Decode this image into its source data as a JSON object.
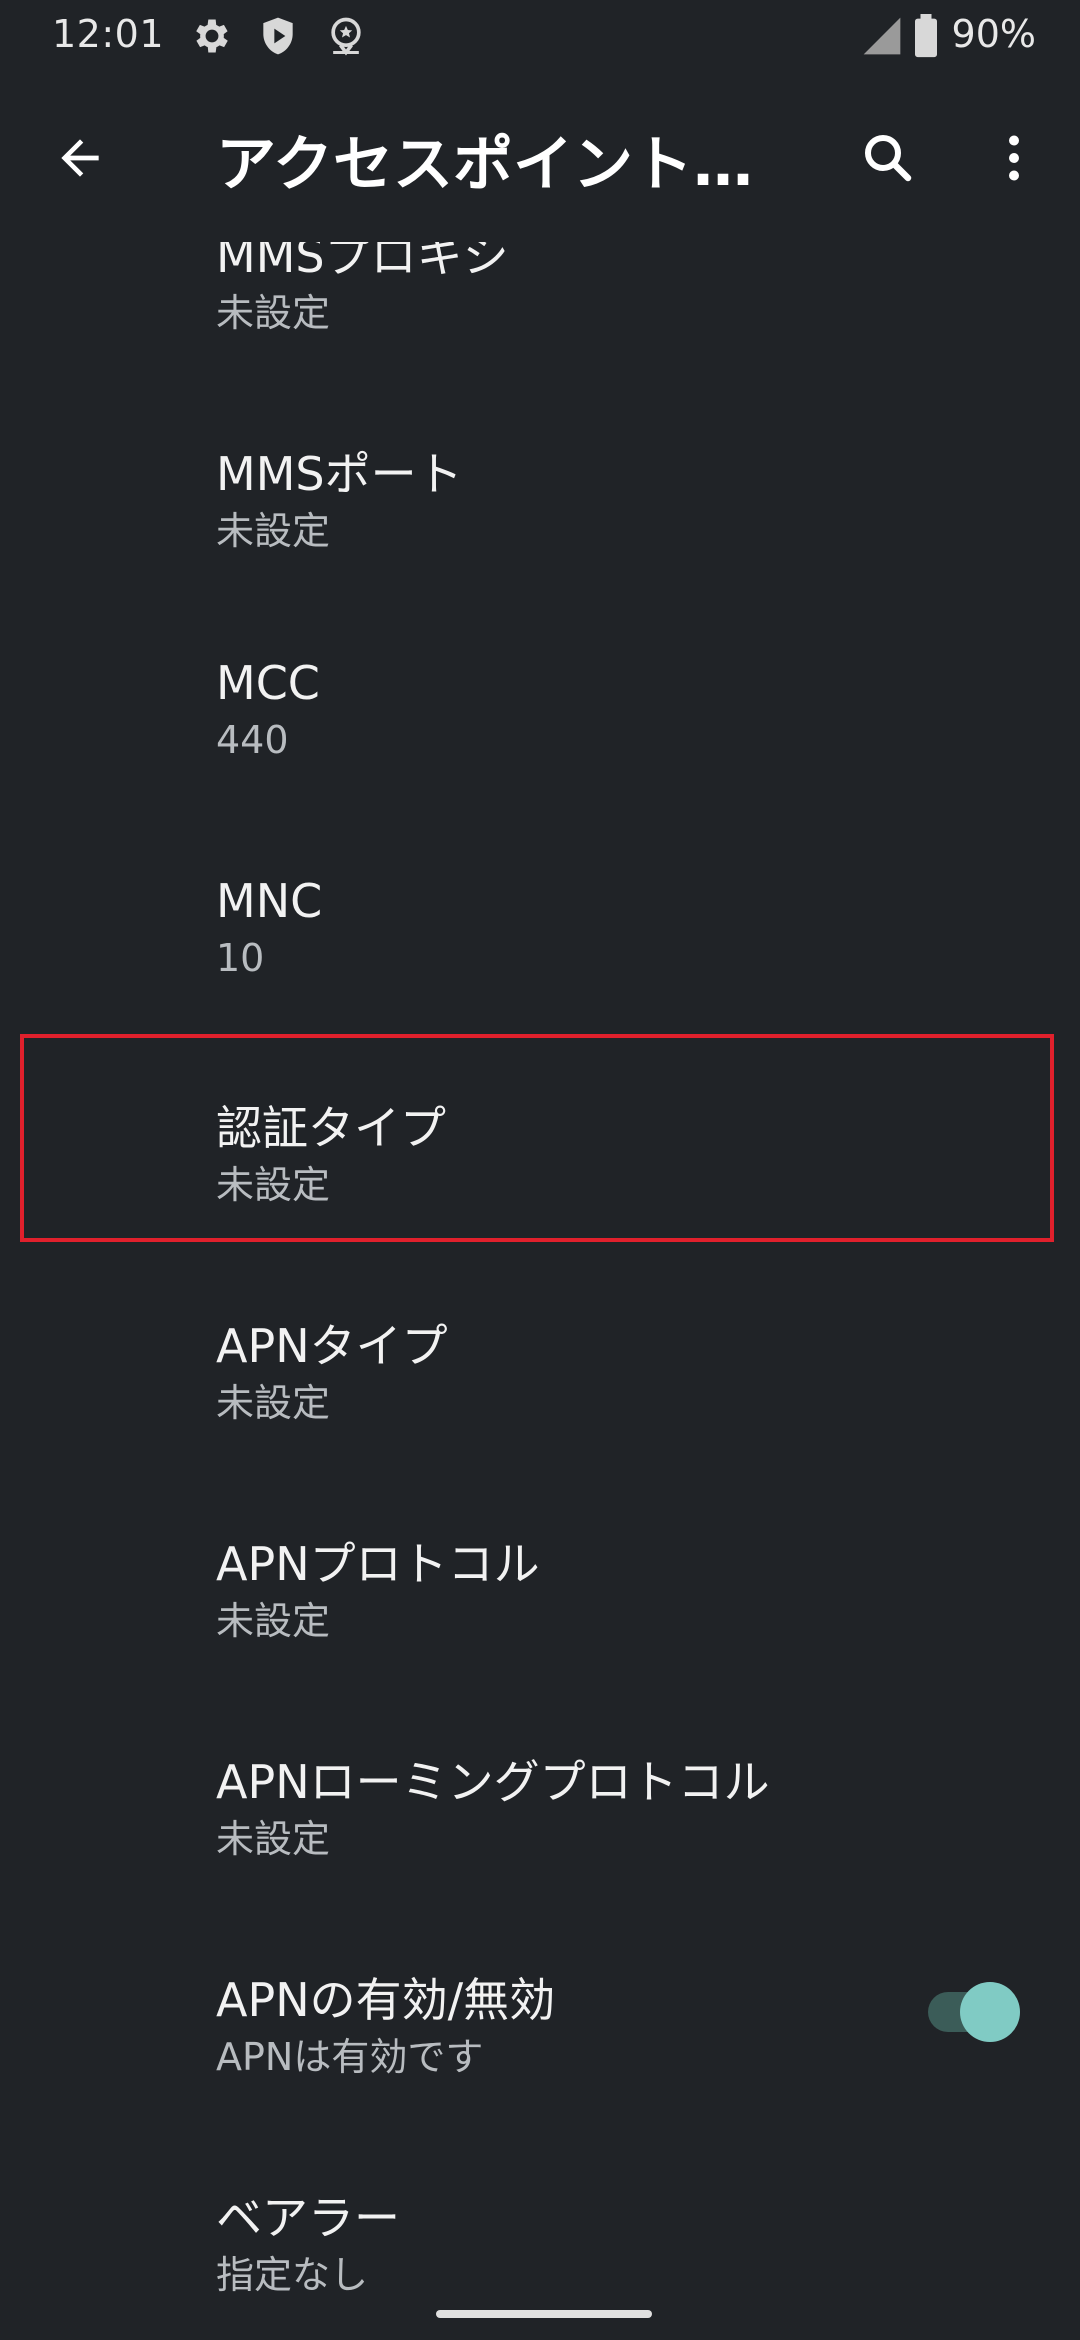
{
  "status_bar": {
    "time": "12:01",
    "battery_percent": "90%",
    "icons": [
      "settings-gear-icon",
      "shield-icon",
      "location-pin-icon",
      "cell-signal-icon",
      "battery-icon"
    ]
  },
  "app_bar": {
    "title": "アクセスポイント…",
    "back_icon": "arrow-back-icon",
    "search_icon": "search-icon",
    "more_icon": "more-vert-icon"
  },
  "colors": {
    "background": "#202327",
    "title_text": "#f2f2f2",
    "summary_text": "#b8bcc0",
    "accent": "#80cbc4",
    "highlight": "#e0202c"
  },
  "items": [
    {
      "title": "MMSプロキシ",
      "summary": "未設定"
    },
    {
      "title": "MMSポート",
      "summary": "未設定"
    },
    {
      "title": "MCC",
      "summary": "440"
    },
    {
      "title": "MNC",
      "summary": "10"
    },
    {
      "title": "認証タイプ",
      "summary": "未設定"
    },
    {
      "title": "APNタイプ",
      "summary": "未設定"
    },
    {
      "title": "APNプロトコル",
      "summary": "未設定"
    },
    {
      "title": "APNローミングプロトコル",
      "summary": "未設定"
    },
    {
      "title": "APNの有効/無効",
      "summary": "APNは有効です",
      "toggle_on": true
    },
    {
      "title": "ベアラー",
      "summary": "指定なし"
    }
  ]
}
